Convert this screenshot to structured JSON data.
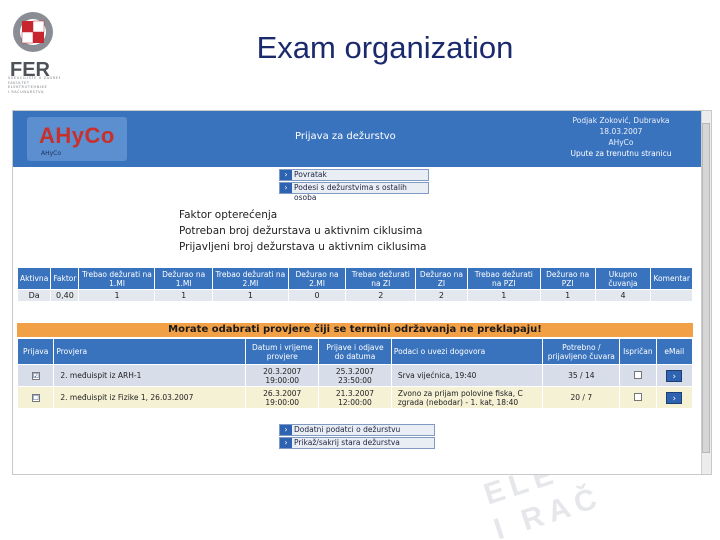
{
  "slide": {
    "title": "Exam organization",
    "logo_text_lines": [
      "SVEUČILIŠTE U ZAGREBU",
      "FAKULTET",
      "ELEKTROTEHNIKE",
      "I RAČUNARSTVA"
    ],
    "watermark_lines": [
      "ELE",
      "I RAČ"
    ]
  },
  "app": {
    "brand": "AHyCo",
    "brand_sub": "AHyCo",
    "title": "Prijava za dežurstvo",
    "user": {
      "name": "Podjak Zoković, Dubravka",
      "date": "18.03.2007",
      "system": "AHyCo",
      "help": "Upute za trenutnu stranicu"
    },
    "nav_top": [
      {
        "label": "Povratak"
      },
      {
        "label": "Podesi s dežurstvima s ostalih osoba"
      }
    ],
    "nav_bottom": [
      {
        "label": "Dodatni podatci o dežurstvu"
      },
      {
        "label": "Prikaž/sakrij stara dežurstva"
      }
    ],
    "stats": [
      "Faktor opterećenja",
      "Potreban broj dežurstava u aktivnim ciklusima",
      "Prijavljeni broj dežurstava u aktivnim ciklusima"
    ],
    "table1": {
      "headers": [
        "Aktivna",
        "Faktor",
        "Trebao dežurati na 1.MI",
        "Dežurao na 1.MI",
        "Trebao dežurati na 2.MI",
        "Dežurao na 2.MI",
        "Trebao dežurati na ZI",
        "Dežurao na ZI",
        "Trebao dežurati na PZI",
        "Dežurao na PZI",
        "Ukupno čuvanja",
        "Komentar"
      ],
      "row": [
        "Da",
        "0,40",
        "1",
        "1",
        "1",
        "0",
        "2",
        "2",
        "1",
        "1",
        "4",
        ""
      ]
    },
    "warning": "Morate odabrati provjere čiji se termini održavanja ne preklapaju!",
    "table2": {
      "headers": [
        "Prijava",
        "Provjera",
        "Datum i vrijeme provjere",
        "Prijave i odjave do datuma",
        "Podaci o uvezi dogovora",
        "Potrebno / prijavljeno čuvara",
        "Ispričan",
        "eMail"
      ],
      "rows": [
        {
          "checked": "☑",
          "exam": "2. međuispit iz ARH-1",
          "date": "20.3.2007 19:00:00",
          "deadline": "25.3.2007 23:50:00",
          "info": "Srva vijećnica, 19:40",
          "ratio": "35 / 14"
        },
        {
          "checked": "☐",
          "exam": "2. međuispit iz Fizike 1, 26.03.2007",
          "date": "26.3.2007 19:00:00",
          "deadline": "21.3.2007 12:00:00",
          "info": "Zvono za prijam polovine fiska, C zgrada (nebodar) - 1. kat, 18:40",
          "ratio": "20 / 7"
        }
      ],
      "go_symbol": "›"
    }
  }
}
